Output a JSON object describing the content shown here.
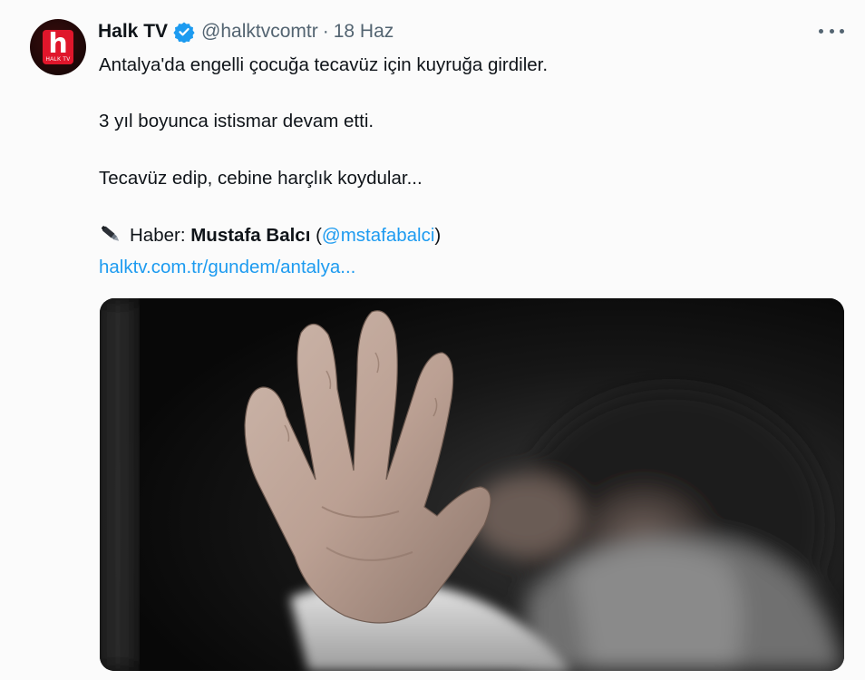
{
  "tweet": {
    "author": {
      "display_name": "Halk TV",
      "handle": "@halktvcomtr",
      "separator": "·",
      "date": "18 Haz",
      "avatar_letter": "h",
      "avatar_sub": "HALK TV",
      "verified_icon": "verified-badge-icon"
    },
    "more_icon": "more-options-icon",
    "body": {
      "line1": "Antalya'da engelli çocuğa tecavüz için kuyruğa girdiler.",
      "line2": "3 yıl boyunca istismar devam etti.",
      "line3": "Tecavüz edip, cebine harçlık koydular...",
      "credit_prefix": "Haber:",
      "credit_name": "Mustafa Balcı",
      "credit_open": "(",
      "credit_handle": "@mstafabalci",
      "credit_close": ")",
      "credit_icon": "pen-icon",
      "link": "halktv.com.tr/gundem/antalya..."
    },
    "media": {
      "description_icon": "photo-raised-hand-child"
    }
  },
  "colors": {
    "text": "#0f1419",
    "secondary": "#536471",
    "link": "#1d9bf0",
    "verified": "#1d9bf0",
    "brand_red": "#e0162b"
  }
}
